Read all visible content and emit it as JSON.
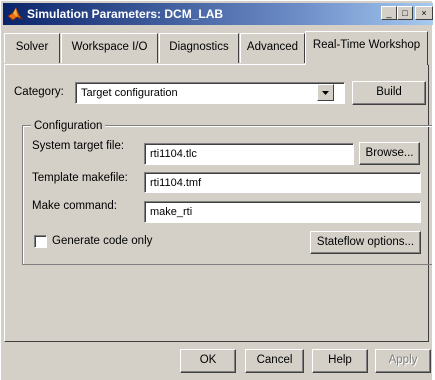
{
  "window": {
    "title": "Simulation Parameters: DCM_LAB",
    "minimize_glyph": "_",
    "maximize_glyph": "□",
    "close_glyph": "×"
  },
  "tabs": [
    {
      "label": "Solver"
    },
    {
      "label": "Workspace I/O"
    },
    {
      "label": "Diagnostics"
    },
    {
      "label": "Advanced"
    },
    {
      "label": "Real-Time Workshop",
      "active": true
    }
  ],
  "category": {
    "label": "Category:",
    "value": "Target configuration",
    "build_label": "Build"
  },
  "configuration": {
    "legend": "Configuration",
    "system_target_label": "System target file:",
    "system_target_value": "rti1104.tlc",
    "browse_label": "Browse...",
    "template_makefile_label": "Template makefile:",
    "template_makefile_value": "rti1104.tmf",
    "make_command_label": "Make command:",
    "make_command_value": "make_rti",
    "generate_code_only_label": "Generate code only",
    "generate_code_only_checked": false,
    "stateflow_options_label": "Stateflow options..."
  },
  "footer": {
    "ok_label": "OK",
    "cancel_label": "Cancel",
    "help_label": "Help",
    "apply_label": "Apply"
  }
}
